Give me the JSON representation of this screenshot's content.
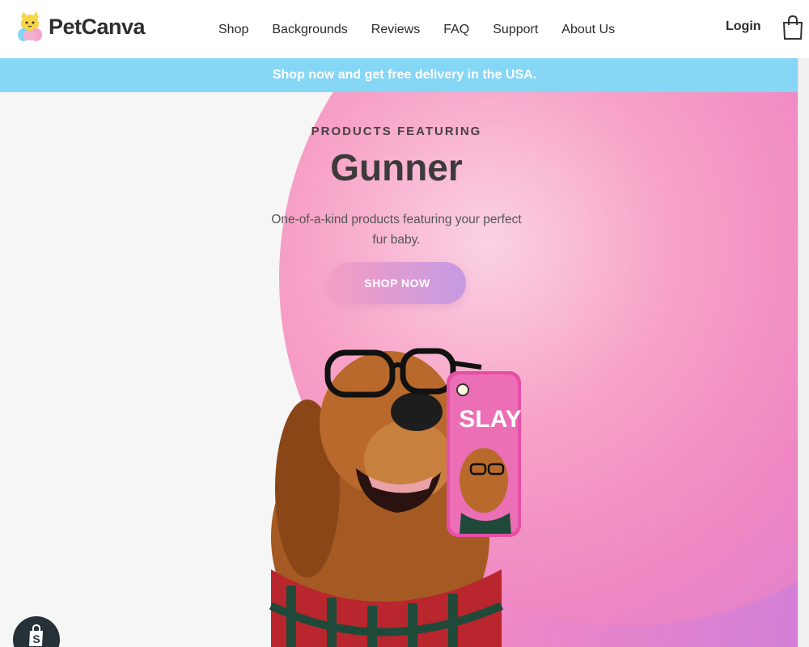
{
  "header": {
    "logo_text": "PetCanva",
    "nav": [
      "Shop",
      "Backgrounds",
      "Reviews",
      "FAQ",
      "Support",
      "About Us"
    ],
    "login_label": "Login"
  },
  "announcement": {
    "text": "Shop now and get free delivery in the USA."
  },
  "hero": {
    "eyebrow": "PRODUCTS FEATURING",
    "title": "Gunner",
    "subtitle": "One-of-a-kind products featuring your perfect fur baby.",
    "cta_label": "SHOP NOW",
    "phone_case_text": "SLAY"
  },
  "icons": {
    "logo": "cat-logo-icon",
    "cart": "shopping-bag-icon",
    "badge": "shopify-bag-icon"
  },
  "colors": {
    "announcement_bg": "#86d6f5",
    "hero_pink": "#ef86c3",
    "hero_purple": "#d47ed7",
    "cta_start": "#f59ec3",
    "cta_end": "#c59ae3"
  }
}
